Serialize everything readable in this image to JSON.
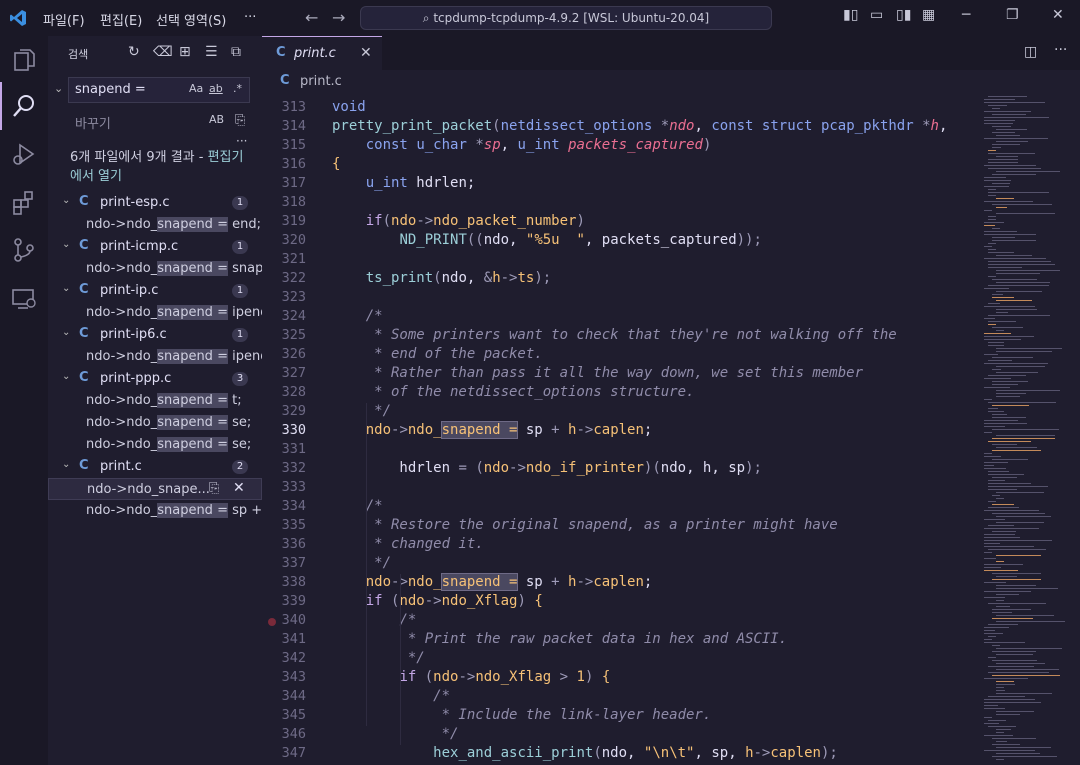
{
  "titlebar": {
    "menus": [
      "파일(F)",
      "편집(E)",
      "선택 영역(S)",
      "···"
    ],
    "command_center": "tcpdump-tcpdump-4.9.2 [WSL: Ubuntu-20.04]"
  },
  "sidebar": {
    "title": "검색",
    "search_value": "snapend =",
    "replace_placeholder": "바꾸기",
    "opt_case": "Aa",
    "opt_word": "ab",
    "opt_regex": ".*",
    "opt_preserve": "AB",
    "summary_text": "6개 파일에서 9개 결과 - ",
    "summary_link": "편집기에서 열기",
    "results": [
      {
        "file": "print-esp.c",
        "count": "1",
        "lines": [
          [
            "ndo->ndo_",
            "snapend =",
            " end;"
          ]
        ]
      },
      {
        "file": "print-icmp.c",
        "count": "1",
        "lines": [
          [
            "ndo->ndo_",
            "snapend =",
            " snape..."
          ]
        ]
      },
      {
        "file": "print-ip.c",
        "count": "1",
        "lines": [
          [
            "ndo->ndo_",
            "snapend =",
            " ipend;"
          ]
        ]
      },
      {
        "file": "print-ip6.c",
        "count": "1",
        "lines": [
          [
            "ndo->ndo_",
            "snapend =",
            " ipend;"
          ]
        ]
      },
      {
        "file": "print-ppp.c",
        "count": "3",
        "lines": [
          [
            "ndo->ndo_",
            "snapend =",
            " t;"
          ],
          [
            "ndo->ndo_",
            "snapend =",
            " se;"
          ],
          [
            "ndo->ndo_",
            "snapend =",
            " se;"
          ]
        ]
      },
      {
        "file": "print.c",
        "count": "2",
        "lines": [
          [
            "ndo->ndo_snape...",
            "",
            ""
          ],
          [
            "ndo->ndo_",
            "snapend =",
            " sp + h..."
          ]
        ]
      }
    ]
  },
  "editor": {
    "tab_label": "print.c",
    "breadcrumb": "print.c",
    "current_line": 330,
    "lines": [
      {
        "n": 313,
        "html": "<span class='k'>void</span>"
      },
      {
        "n": 314,
        "html": "<span class='f'>pretty_print_packet</span><span class='o'>(</span><span class='k'>netdissect_options</span> <span class='o'>*</span><span class='r'>ndo</span>, <span class='k'>const struct</span> <span class='k'>pcap_pkthdr</span> <span class='o'>*</span><span class='r'>h</span>,"
      },
      {
        "n": 315,
        "html": "    <span class='k'>const</span> <span class='k'>u_char</span> <span class='o'>*</span><span class='r'>sp</span>, <span class='k'>u_int</span> <span class='r'>packets_captured</span><span class='o'>)</span>"
      },
      {
        "n": 316,
        "html": "<span class='y'>{</span>"
      },
      {
        "n": 317,
        "html": "    <span class='k'>u_int</span> hdrlen;"
      },
      {
        "n": 318,
        "html": ""
      },
      {
        "n": 319,
        "html": "    <span class='p'>if</span><span class='o'>(</span><span class='y'>ndo</span><span class='o'>-></span><span class='y'>ndo_packet_number</span><span class='o'>)</span>"
      },
      {
        "n": 320,
        "html": "        <span class='f'>ND_PRINT</span><span class='o'>((</span>ndo, <span class='s'>\"%5u  \"</span>, packets_captured<span class='o'>));</span>"
      },
      {
        "n": 321,
        "html": ""
      },
      {
        "n": 322,
        "html": "    <span class='f'>ts_print</span><span class='o'>(</span>ndo, <span class='o'>&</span><span class='y'>h</span><span class='o'>-></span><span class='y'>ts</span><span class='o'>);</span>"
      },
      {
        "n": 323,
        "html": ""
      },
      {
        "n": 324,
        "html": "    <span class='c'>/*</span>"
      },
      {
        "n": 325,
        "html": "<span class='c'>     * Some printers want to check that they're not walking off the</span>"
      },
      {
        "n": 326,
        "html": "<span class='c'>     * end of the packet.</span>"
      },
      {
        "n": 327,
        "html": "<span class='c'>     * Rather than pass it all the way down, we set this member</span>"
      },
      {
        "n": 328,
        "html": "<span class='c'>     * of the netdissect_options structure.</span>"
      },
      {
        "n": 329,
        "html": "<span class='c'>     */</span>"
      },
      {
        "n": 330,
        "html": "    <span class='y'>ndo</span><span class='o'>-></span><span class='y'>ndo_<span class='m'>snapend =</span></span> sp <span class='o'>+</span> <span class='y'>h</span><span class='o'>-></span><span class='y'>caplen</span>;"
      },
      {
        "n": 331,
        "html": ""
      },
      {
        "n": 332,
        "html": "        hdrlen <span class='o'>=</span> <span class='o'>(</span><span class='y'>ndo</span><span class='o'>-></span><span class='y'>ndo_if_printer</span><span class='o'>)(</span>ndo, h, sp<span class='o'>);</span>"
      },
      {
        "n": 333,
        "html": ""
      },
      {
        "n": 334,
        "html": "    <span class='c'>/*</span>"
      },
      {
        "n": 335,
        "html": "<span class='c'>     * Restore the original snapend, as a printer might have</span>"
      },
      {
        "n": 336,
        "html": "<span class='c'>     * changed it.</span>"
      },
      {
        "n": 337,
        "html": "<span class='c'>     */</span>"
      },
      {
        "n": 338,
        "html": "    <span class='y'>ndo</span><span class='o'>-></span><span class='y'>ndo_<span class='m'>snapend =</span></span> sp <span class='o'>+</span> <span class='y'>h</span><span class='o'>-></span><span class='y'>caplen</span>;"
      },
      {
        "n": 339,
        "html": "    <span class='p'>if</span> <span class='o'>(</span><span class='y'>ndo</span><span class='o'>-></span><span class='y'>ndo_Xflag</span><span class='o'>)</span> <span class='y'>{</span>"
      },
      {
        "n": 340,
        "html": "        <span class='c'>/*</span>"
      },
      {
        "n": 341,
        "html": "<span class='c'>         * Print the raw packet data in hex and ASCII.</span>"
      },
      {
        "n": 342,
        "html": "<span class='c'>         */</span>"
      },
      {
        "n": 343,
        "html": "        <span class='p'>if</span> <span class='o'>(</span><span class='y'>ndo</span><span class='o'>-></span><span class='y'>ndo_Xflag</span> <span class='o'>></span> <span class='s'>1</span><span class='o'>)</span> <span class='y'>{</span>"
      },
      {
        "n": 344,
        "html": "            <span class='c'>/*</span>"
      },
      {
        "n": 345,
        "html": "<span class='c'>             * Include the link-layer header.</span>"
      },
      {
        "n": 346,
        "html": "<span class='c'>             */</span>"
      },
      {
        "n": 347,
        "html": "            <span class='f'>hex_and_ascii_print</span><span class='o'>(</span>ndo, <span class='s'>\"\\n\\t\"</span>, sp, <span class='y'>h</span><span class='o'>-></span><span class='y'>caplen</span><span class='o'>);</span>"
      }
    ]
  }
}
